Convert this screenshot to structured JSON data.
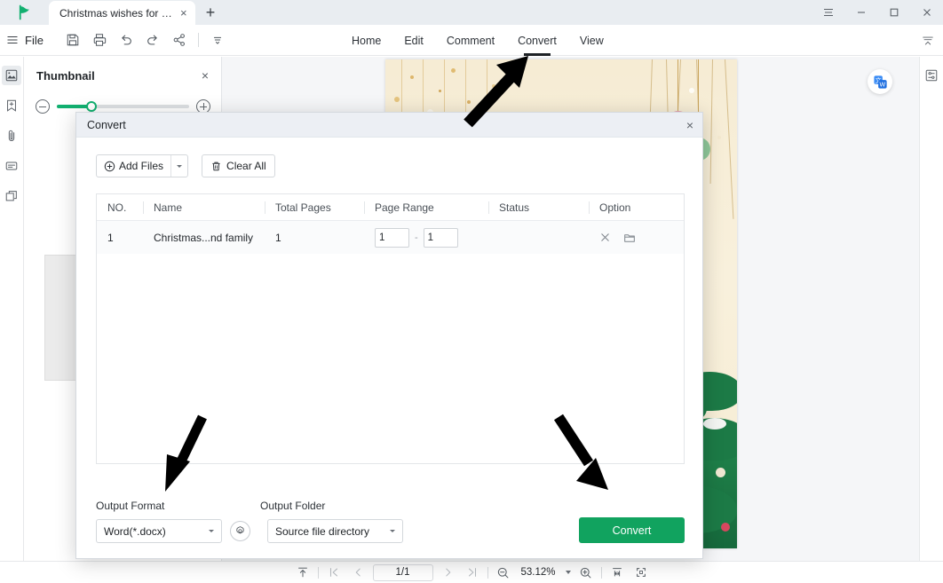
{
  "window": {
    "tab_label": "Christmas wishes for frie...",
    "tab_close": "×",
    "new_tab": "+",
    "menu_icon": "menu-icon",
    "minimize": "—",
    "maximize": "□",
    "close": "×"
  },
  "toolbar": {
    "file_label": "File",
    "icons": [
      "save-icon",
      "print-icon",
      "undo-icon",
      "redo-icon",
      "share-icon",
      "more-icon"
    ],
    "menus": [
      {
        "label": "Home",
        "active": false
      },
      {
        "label": "Edit",
        "active": false
      },
      {
        "label": "Comment",
        "active": false
      },
      {
        "label": "Convert",
        "active": true
      },
      {
        "label": "View",
        "active": false
      }
    ]
  },
  "left_rail": {
    "items": [
      {
        "name": "thumbnail-icon",
        "active": true
      },
      {
        "name": "bookmark-add-icon",
        "active": false
      },
      {
        "name": "attachment-icon",
        "active": false
      },
      {
        "name": "annotation-icon",
        "active": false
      },
      {
        "name": "layers-icon",
        "active": false
      }
    ]
  },
  "thumbnail_panel": {
    "title": "Thumbnail",
    "close": "×",
    "zoom_out_icon": "zoom-out-icon",
    "zoom_in_icon": "zoom-in-icon",
    "slider_value": 22
  },
  "right_rail": {
    "panel_icon": "properties-panel-icon"
  },
  "floating": {
    "translate_icon": "translate-icon"
  },
  "statusbar": {
    "fit_icon": "fit-page-icon",
    "first_page_icon": "first-page-icon",
    "prev_page_icon": "prev-page-icon",
    "page_value": "1/1",
    "next_page_icon": "next-page-icon",
    "last_page_icon": "last-page-icon",
    "zoom_out_icon": "zoom-out-icon",
    "zoom_level": "53.12%",
    "zoom_in_icon": "zoom-in-icon",
    "fit_width_icon": "fit-width-icon",
    "fullscreen_icon": "fullscreen-icon"
  },
  "dialog": {
    "title": "Convert",
    "close": "×",
    "add_files_label": "Add Files",
    "add_files_icon": "plus-circle-icon",
    "clear_all_label": "Clear All",
    "clear_all_icon": "trash-icon",
    "table": {
      "headers": [
        "NO.",
        "Name",
        "Total Pages",
        "Page Range",
        "Status",
        "Option"
      ],
      "rows": [
        {
          "no": "1",
          "name": "Christmas...nd family",
          "total_pages": "1",
          "range_from": "1",
          "range_dash": "-",
          "range_to": "1",
          "status": "",
          "option_remove_icon": "close-icon",
          "option_folder_icon": "folder-icon"
        }
      ]
    },
    "output_format_label": "Output Format",
    "output_folder_label": "Output Folder",
    "output_format_value": "Word(*.docx)",
    "output_folder_value": "Source file directory",
    "settings_icon": "gear-icon",
    "convert_button": "Convert"
  },
  "colors": {
    "accent_green": "#11a35f",
    "slider_green": "#12b070",
    "titlebar_bg": "#e9edf1",
    "dialog_header_bg": "#eceff4",
    "page_bg": "#f8f0dc"
  }
}
